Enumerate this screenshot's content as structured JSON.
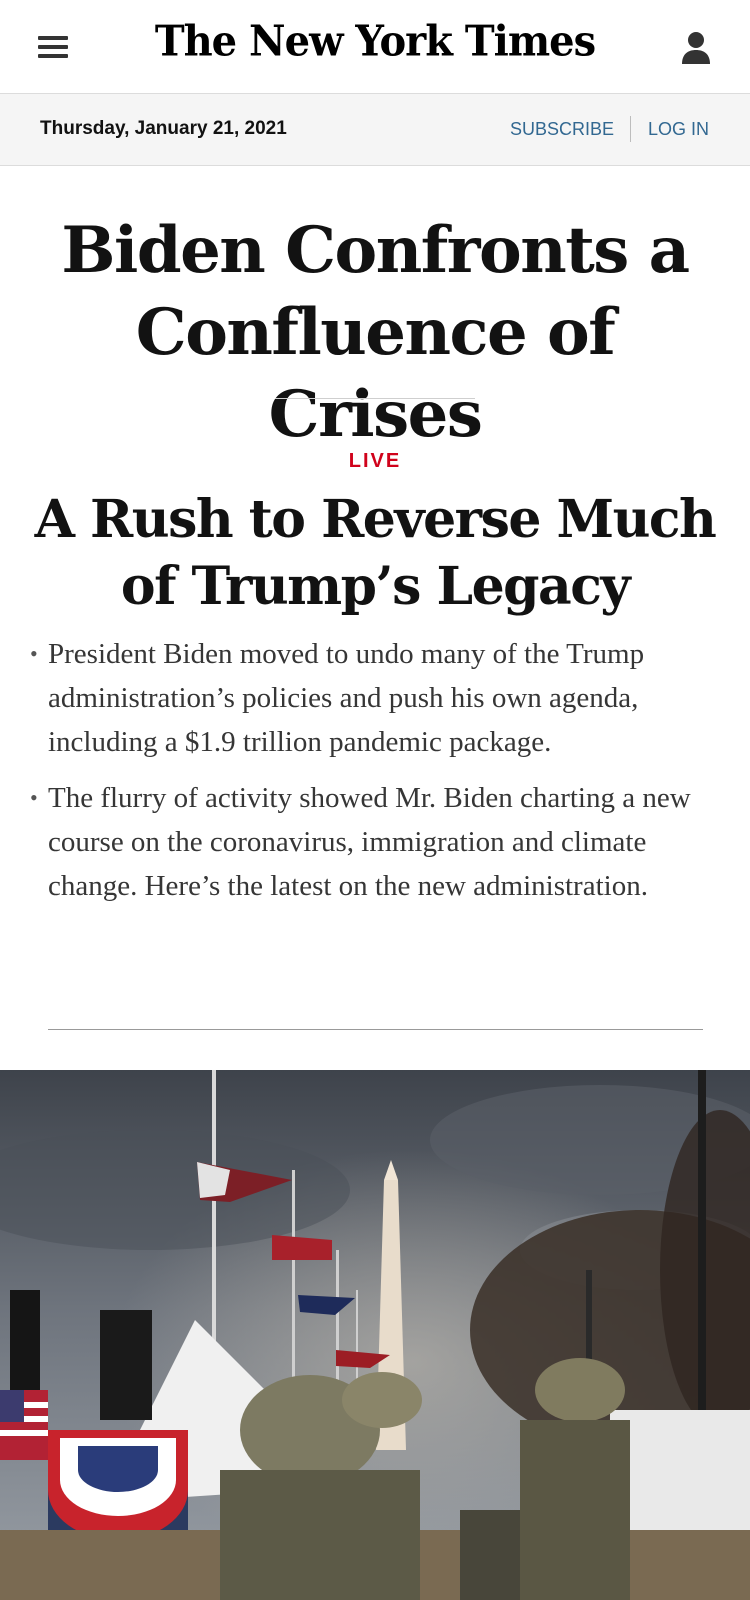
{
  "header": {
    "logo": "The New York Times",
    "menu_icon": "hamburger-menu-icon",
    "account_icon": "person-icon"
  },
  "datebar": {
    "date": "Thursday, January 21, 2021",
    "subscribe": "SUBSCRIBE",
    "login": "LOG IN"
  },
  "main": {
    "headline": "Biden Confronts a Confluence of Crises",
    "live_label": "LIVE",
    "subheadline": "A Rush to Reverse Much of Trump’s Legacy",
    "summary": [
      "President Biden moved to undo many of the Trump administration’s policies and push his own agenda, including a $1.9 trillion pandemic package.",
      "The flurry of activity showed Mr. Biden charting a new course on the coronavirus, immigration and climate change. Here’s the latest on the new administration."
    ]
  },
  "colors": {
    "link": "#326891",
    "live": "#d0021b",
    "datebar_bg": "#f5f5f5"
  }
}
